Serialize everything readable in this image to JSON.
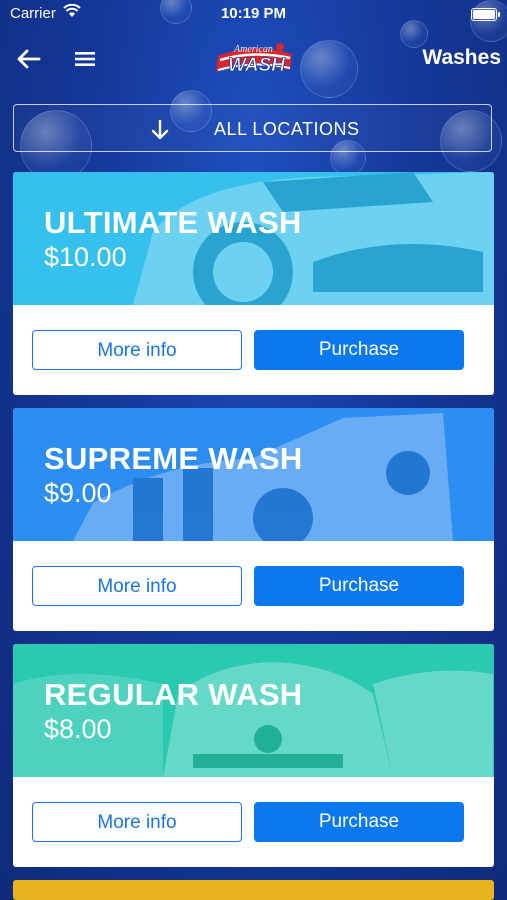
{
  "status_bar": {
    "carrier": "Carrier",
    "time": "10:19 PM"
  },
  "nav": {
    "title": "Washes",
    "logo_text_top": "American",
    "logo_text": "WASH"
  },
  "location_selector": {
    "label": "ALL LOCATIONS"
  },
  "washes": [
    {
      "name": "ULTIMATE WASH",
      "price": "$10.00",
      "more_info_label": "More info",
      "purchase_label": "Purchase",
      "color": "#35c0ee"
    },
    {
      "name": "SUPREME WASH",
      "price": "$9.00",
      "more_info_label": "More info",
      "purchase_label": "Purchase",
      "color": "#2e8df0"
    },
    {
      "name": "REGULAR WASH",
      "price": "$8.00",
      "more_info_label": "More info",
      "purchase_label": "Purchase",
      "color": "#2ac9b2"
    }
  ],
  "colors": {
    "background": "#15389a",
    "accent": "#0a78f0",
    "next_card": "#e6b51e"
  }
}
